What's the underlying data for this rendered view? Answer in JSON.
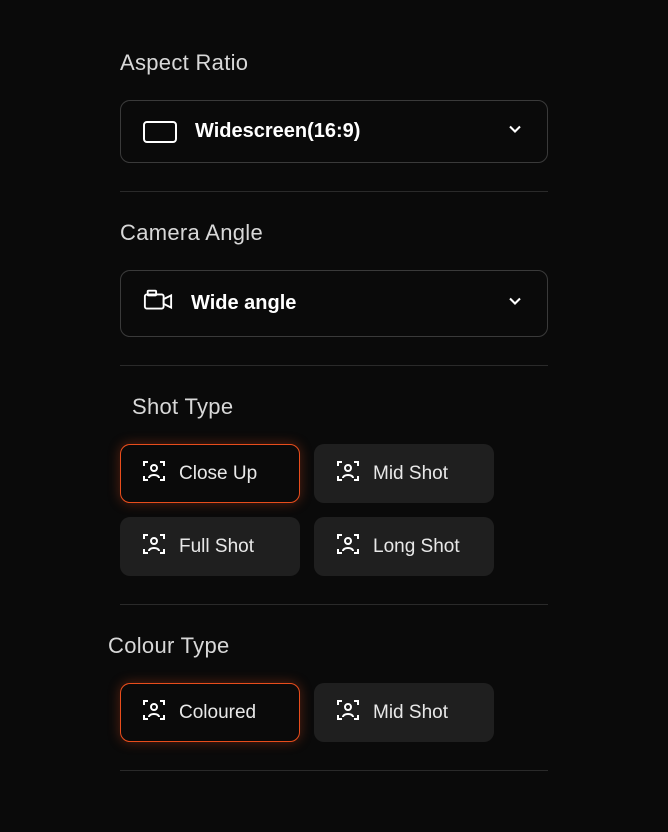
{
  "aspectRatio": {
    "title": "Aspect Ratio",
    "selected": "Widescreen(16:9)"
  },
  "cameraAngle": {
    "title": "Camera Angle",
    "selected": "Wide angle"
  },
  "shotType": {
    "title": "Shot Type",
    "options": [
      {
        "label": "Close Up",
        "selected": true
      },
      {
        "label": "Mid Shot",
        "selected": false
      },
      {
        "label": "Full Shot",
        "selected": false
      },
      {
        "label": "Long Shot",
        "selected": false
      }
    ]
  },
  "colourType": {
    "title": "Colour Type",
    "options": [
      {
        "label": "Coloured",
        "selected": true
      },
      {
        "label": "Mid Shot",
        "selected": false
      }
    ]
  }
}
